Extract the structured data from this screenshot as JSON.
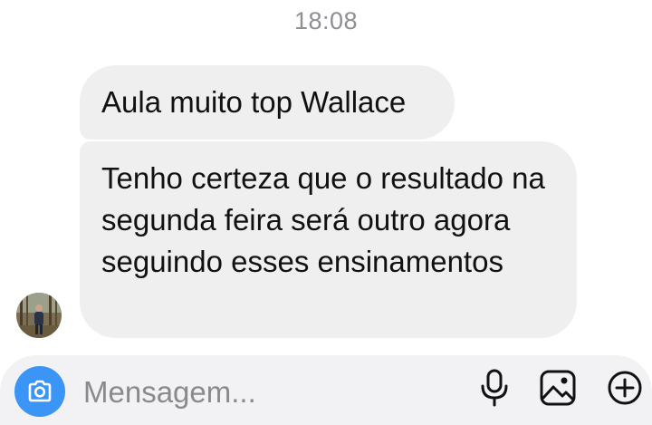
{
  "chat": {
    "timestamp": "18:08",
    "messages": [
      {
        "text": "Aula muito top Wallace"
      },
      {
        "text": "Tenho certeza que o resultado na segunda feira será outro agora seguindo esses ensinamentos"
      }
    ]
  },
  "composer": {
    "placeholder": "Mensagem...",
    "icons": {
      "camera": "camera-icon",
      "mic": "microphone-icon",
      "gallery": "image-gallery-icon",
      "add": "plus-circle-icon"
    }
  },
  "colors": {
    "bubble_background": "#efefef",
    "camera_button": "#3a95f6",
    "timestamp_text": "#8e8e93",
    "composer_background": "#f2f2f4"
  }
}
